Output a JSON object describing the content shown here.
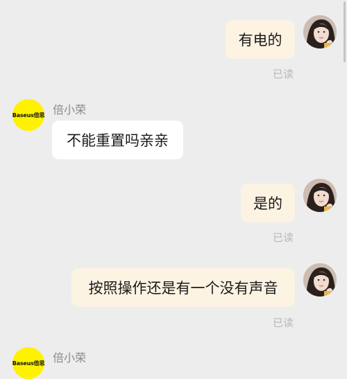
{
  "messages": [
    {
      "from": "me",
      "text": "有电的",
      "status": "已读"
    },
    {
      "from": "them",
      "sender": "倍小荣",
      "text": "不能重置吗亲亲"
    },
    {
      "from": "me",
      "text": "是的",
      "status": "已读"
    },
    {
      "from": "me",
      "text": "按照操作还是有一个没有声音",
      "status": "已读"
    },
    {
      "from": "them",
      "sender": "倍小荣",
      "text": ""
    }
  ],
  "bot_avatar": {
    "logo_text": "Baseus倍思"
  },
  "colors": {
    "background": "#ededed",
    "my_bubble": "#fdf3e3",
    "their_bubble": "#ffffff",
    "bot_avatar": "#fff200",
    "read_status": "#b8b8b8"
  },
  "icons": [
    "user-avatar-icon",
    "baseus-logo-icon"
  ]
}
